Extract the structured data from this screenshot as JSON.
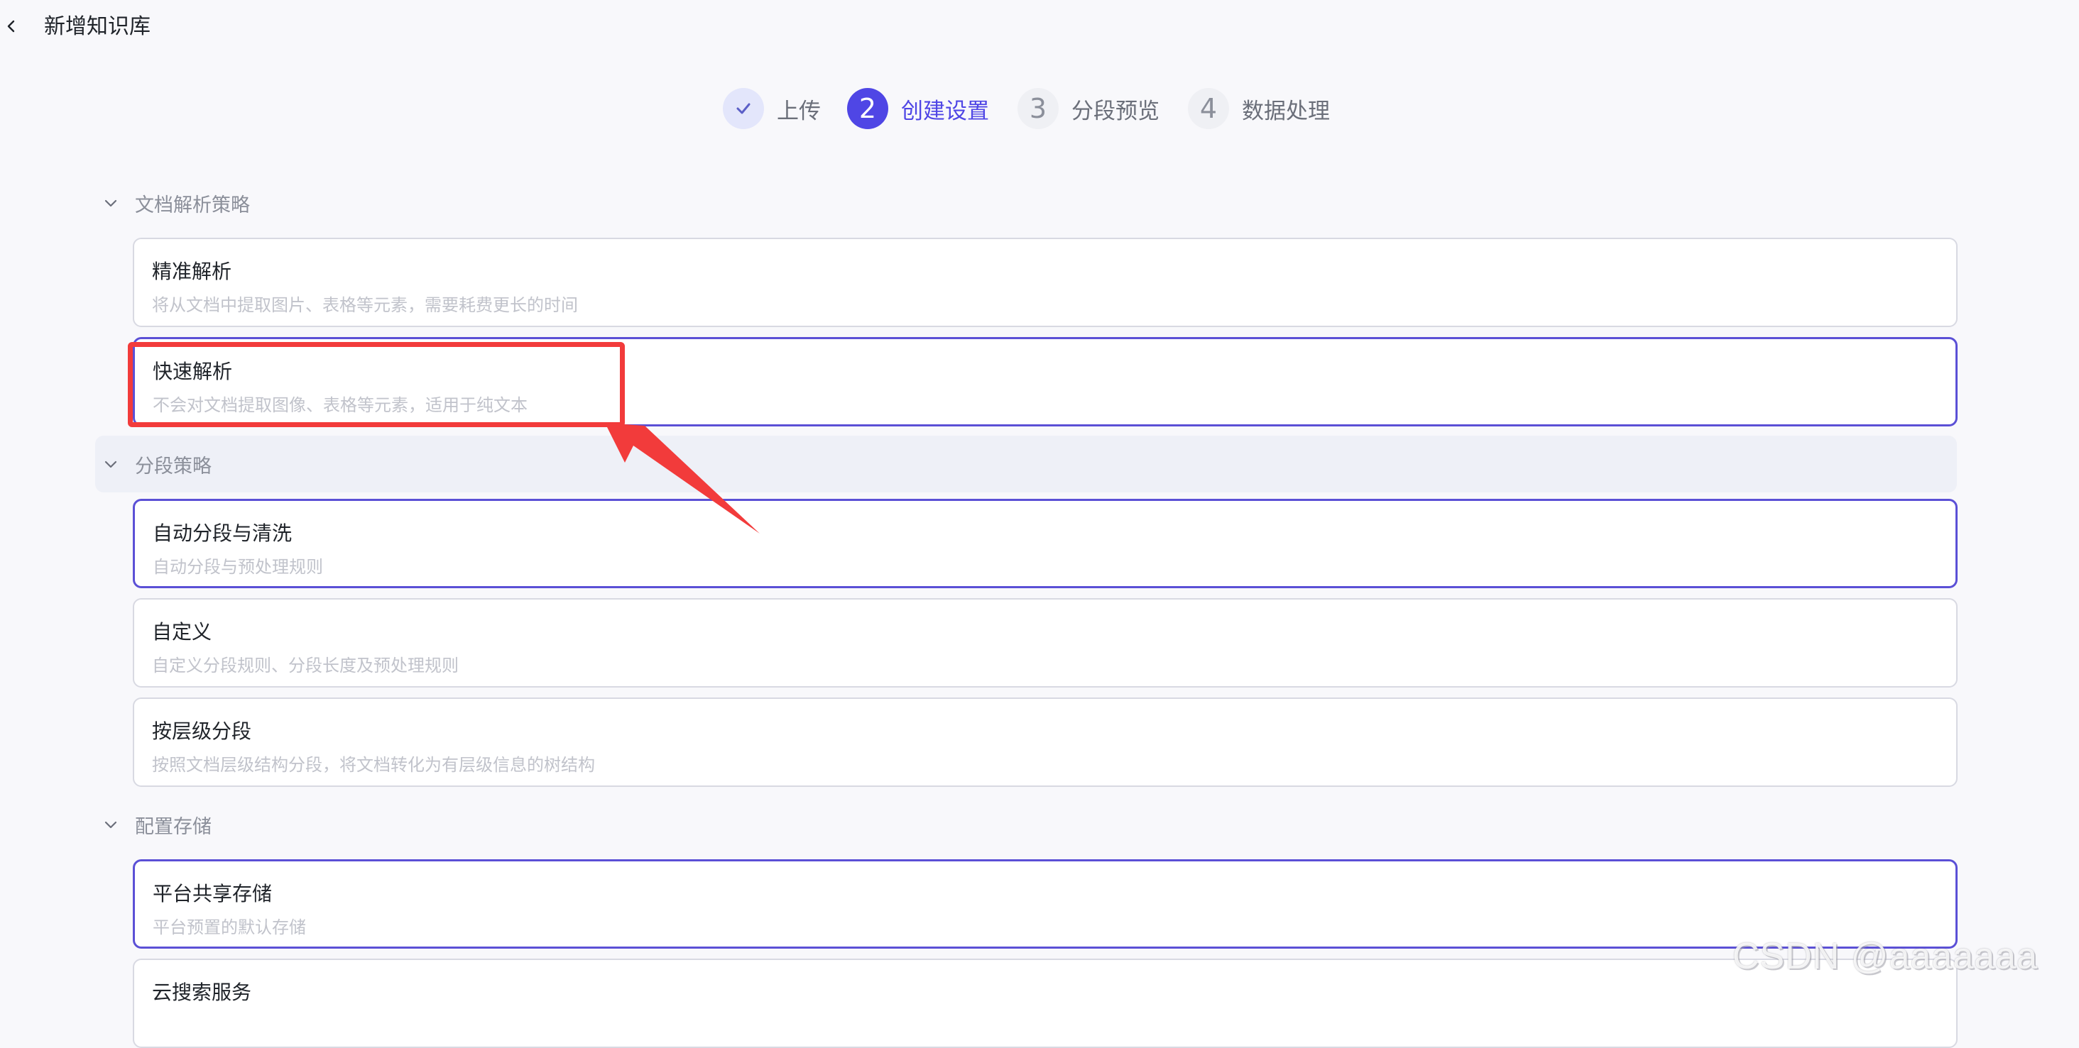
{
  "header": {
    "title": "新增知识库",
    "back_icon": "chevron-left-icon"
  },
  "stepper": {
    "steps": [
      {
        "number": "✓",
        "label": "上传",
        "state": "done"
      },
      {
        "number": "2",
        "label": "创建设置",
        "state": "active"
      },
      {
        "number": "3",
        "label": "分段预览",
        "state": "pending"
      },
      {
        "number": "4",
        "label": "数据处理",
        "state": "pending"
      }
    ]
  },
  "sections": [
    {
      "title": "文档解析策略",
      "expanded": true,
      "options": [
        {
          "title": "精准解析",
          "desc": "将从文档中提取图片、表格等元素，需要耗费更长的时间",
          "selected": false
        },
        {
          "title": "快速解析",
          "desc": "不会对文档提取图像、表格等元素，适用于纯文本",
          "selected": true
        }
      ]
    },
    {
      "title": "分段策略",
      "expanded": true,
      "options": [
        {
          "title": "自动分段与清洗",
          "desc": "自动分段与预处理规则",
          "selected": true
        },
        {
          "title": "自定义",
          "desc": "自定义分段规则、分段长度及预处理规则",
          "selected": false
        },
        {
          "title": "按层级分段",
          "desc": "按照文档层级结构分段，将文档转化为有层级信息的树结构",
          "selected": false
        }
      ]
    },
    {
      "title": "配置存储",
      "expanded": true,
      "options": [
        {
          "title": "平台共享存储",
          "desc": "平台预置的默认存储",
          "selected": true
        },
        {
          "title": "云搜索服务",
          "desc": "",
          "selected": false
        }
      ]
    }
  ],
  "watermark": "CSDN @aaaaaaa",
  "colors": {
    "accent": "#4f46e5",
    "selected_border": "#5b50d6",
    "annotation": "#f23b3b",
    "background": "#f8f8fb"
  }
}
